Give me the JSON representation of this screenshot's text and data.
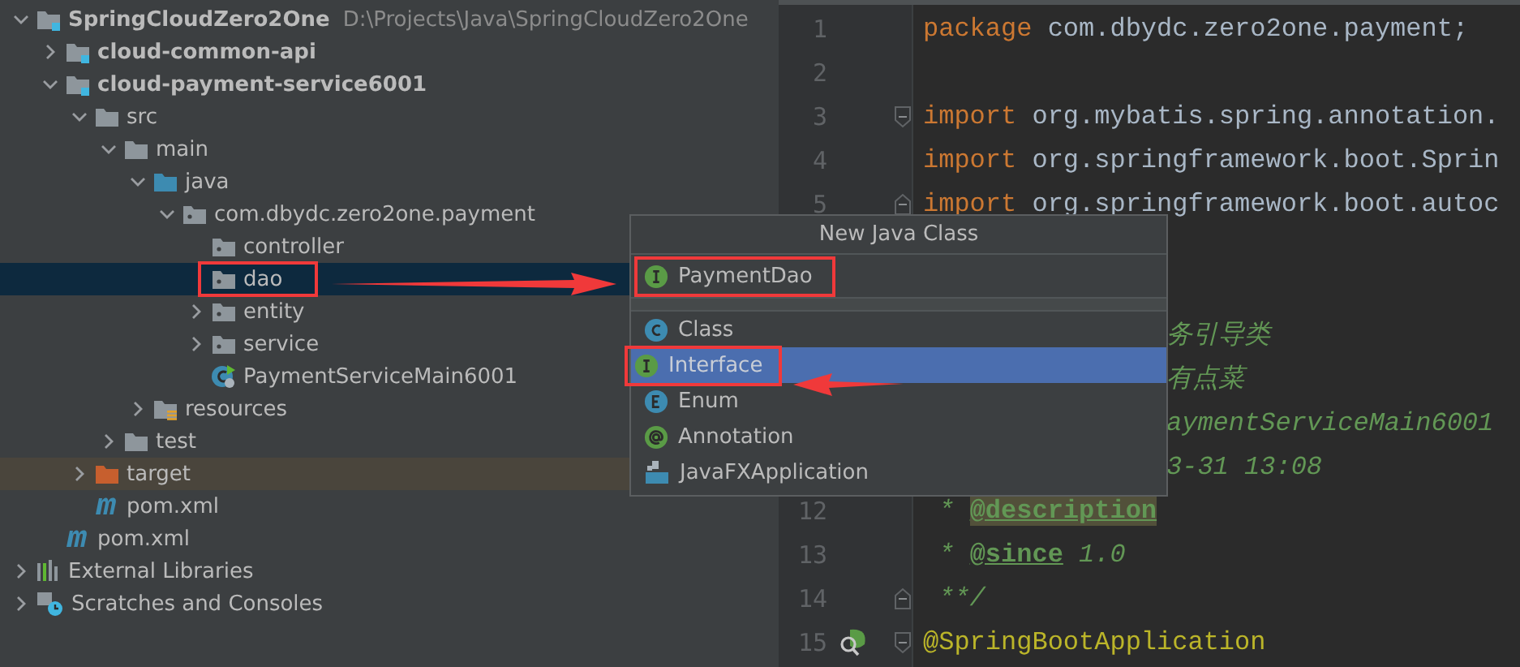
{
  "project_tree": [
    {
      "label": "SpringCloudZero2One",
      "path": "D:\\Projects\\Java\\SpringCloudZero2One",
      "kind": "module",
      "expanded": true,
      "selected": false,
      "children": [
        {
          "label": "cloud-common-api",
          "kind": "module",
          "expanded": false,
          "selected": false
        },
        {
          "label": "cloud-payment-service6001",
          "kind": "module",
          "expanded": true,
          "selected": false,
          "children": [
            {
              "label": "src",
              "kind": "folder",
              "expanded": true,
              "selected": false,
              "children": [
                {
                  "label": "main",
                  "kind": "folder",
                  "expanded": true,
                  "selected": false,
                  "children": [
                    {
                      "label": "java",
                      "kind": "source",
                      "expanded": true,
                      "selected": false,
                      "children": [
                        {
                          "label": "com.dbydc.zero2one.payment",
                          "kind": "package",
                          "expanded": true,
                          "selected": false,
                          "children": [
                            {
                              "label": "controller",
                              "kind": "package",
                              "selected": false
                            },
                            {
                              "label": "dao",
                              "kind": "package",
                              "selected": true,
                              "annotated": true
                            },
                            {
                              "label": "entity",
                              "kind": "package",
                              "expanded": false,
                              "selected": false
                            },
                            {
                              "label": "service",
                              "kind": "package",
                              "expanded": false,
                              "selected": false
                            },
                            {
                              "label": "PaymentServiceMain6001",
                              "kind": "spring_class",
                              "selected": false
                            }
                          ]
                        }
                      ]
                    },
                    {
                      "label": "resources",
                      "kind": "resources",
                      "expanded": false,
                      "selected": false
                    }
                  ]
                },
                {
                  "label": "test",
                  "kind": "folder",
                  "expanded": false,
                  "selected": false
                }
              ]
            },
            {
              "label": "target",
              "kind": "excluded",
              "expanded": false,
              "selected": false
            },
            {
              "label": "pom.xml",
              "kind": "maven",
              "selected": false
            }
          ]
        },
        {
          "label": "pom.xml",
          "kind": "maven",
          "selected": false
        }
      ]
    },
    {
      "label": "External Libraries",
      "kind": "libraries",
      "expanded": false,
      "selected": false
    },
    {
      "label": "Scratches and Consoles",
      "kind": "scratches",
      "expanded": false,
      "selected": false
    }
  ],
  "editor": {
    "lines": [
      {
        "kind": "code",
        "number": "1",
        "tokens": [
          {
            "kind": "keyword",
            "text": "package"
          },
          {
            "kind": "plain",
            "text": " com.dbydc.zero2one.payment;"
          }
        ]
      },
      {
        "kind": "code",
        "number": "2"
      },
      {
        "kind": "code",
        "number": "3",
        "fold": {
          "kind": "start"
        },
        "tokens": [
          {
            "kind": "keyword",
            "text": "import"
          },
          {
            "kind": "plain",
            "text": " org.mybatis.spring.annotation."
          }
        ]
      },
      {
        "kind": "code",
        "number": "4",
        "tokens": [
          {
            "kind": "keyword",
            "text": "import"
          },
          {
            "kind": "plain",
            "text": " org.springframework.boot.Sprin"
          }
        ]
      },
      {
        "kind": "code",
        "number": "5",
        "fold": {
          "kind": "end"
        },
        "tokens": [
          {
            "kind": "keyword",
            "text": "import"
          },
          {
            "kind": "plain",
            "text": " org.springframework.boot.autoc"
          }
        ]
      },
      {
        "kind": "covered"
      },
      {
        "kind": "covered"
      },
      {
        "kind": "fragment",
        "tokens": [
          {
            "kind": "comment",
            "text": "务引导类"
          }
        ]
      },
      {
        "kind": "fragment",
        "tokens": [
          {
            "kind": "comment",
            "text": "有点菜"
          }
        ]
      },
      {
        "kind": "fragment",
        "tokens": [
          {
            "kind": "comment",
            "text": "aymentServiceMain6001"
          }
        ]
      },
      {
        "kind": "fragment",
        "tokens": [
          {
            "kind": "comment",
            "text": "3-31 13:08"
          }
        ]
      },
      {
        "kind": "code",
        "number": "12",
        "tokens": [
          {
            "kind": "comment",
            "text": " * "
          },
          {
            "kind": "doctag_marked",
            "text": "@description"
          }
        ]
      },
      {
        "kind": "code",
        "number": "13",
        "tokens": [
          {
            "kind": "comment",
            "text": " * "
          },
          {
            "kind": "doctag",
            "text": "@since"
          },
          {
            "kind": "comment",
            "text": " 1.0"
          }
        ]
      },
      {
        "kind": "code",
        "number": "14",
        "fold": {
          "kind": "end"
        },
        "tokens": [
          {
            "kind": "comment",
            "text": " **/"
          }
        ]
      },
      {
        "kind": "code",
        "number": "15",
        "fold": {
          "kind": "start"
        },
        "gutter_marker": {
          "kind": "bean"
        },
        "tokens": [
          {
            "kind": "annotation",
            "text": "@SpringBootApplication"
          }
        ]
      }
    ]
  },
  "new_class_popup": {
    "title": "New Java Class",
    "name_value": "PaymentDao",
    "name_icon": {
      "kind": "interface"
    },
    "annotated": true,
    "kinds": [
      {
        "label": "Class",
        "kind": "class",
        "selected": false
      },
      {
        "label": "Interface",
        "kind": "interface",
        "selected": true,
        "annotated": true
      },
      {
        "label": "Enum",
        "kind": "enum",
        "selected": false
      },
      {
        "label": "Annotation",
        "kind": "annotation",
        "selected": false
      },
      {
        "label": "JavaFXApplication",
        "kind": "javafx",
        "selected": false
      }
    ]
  }
}
